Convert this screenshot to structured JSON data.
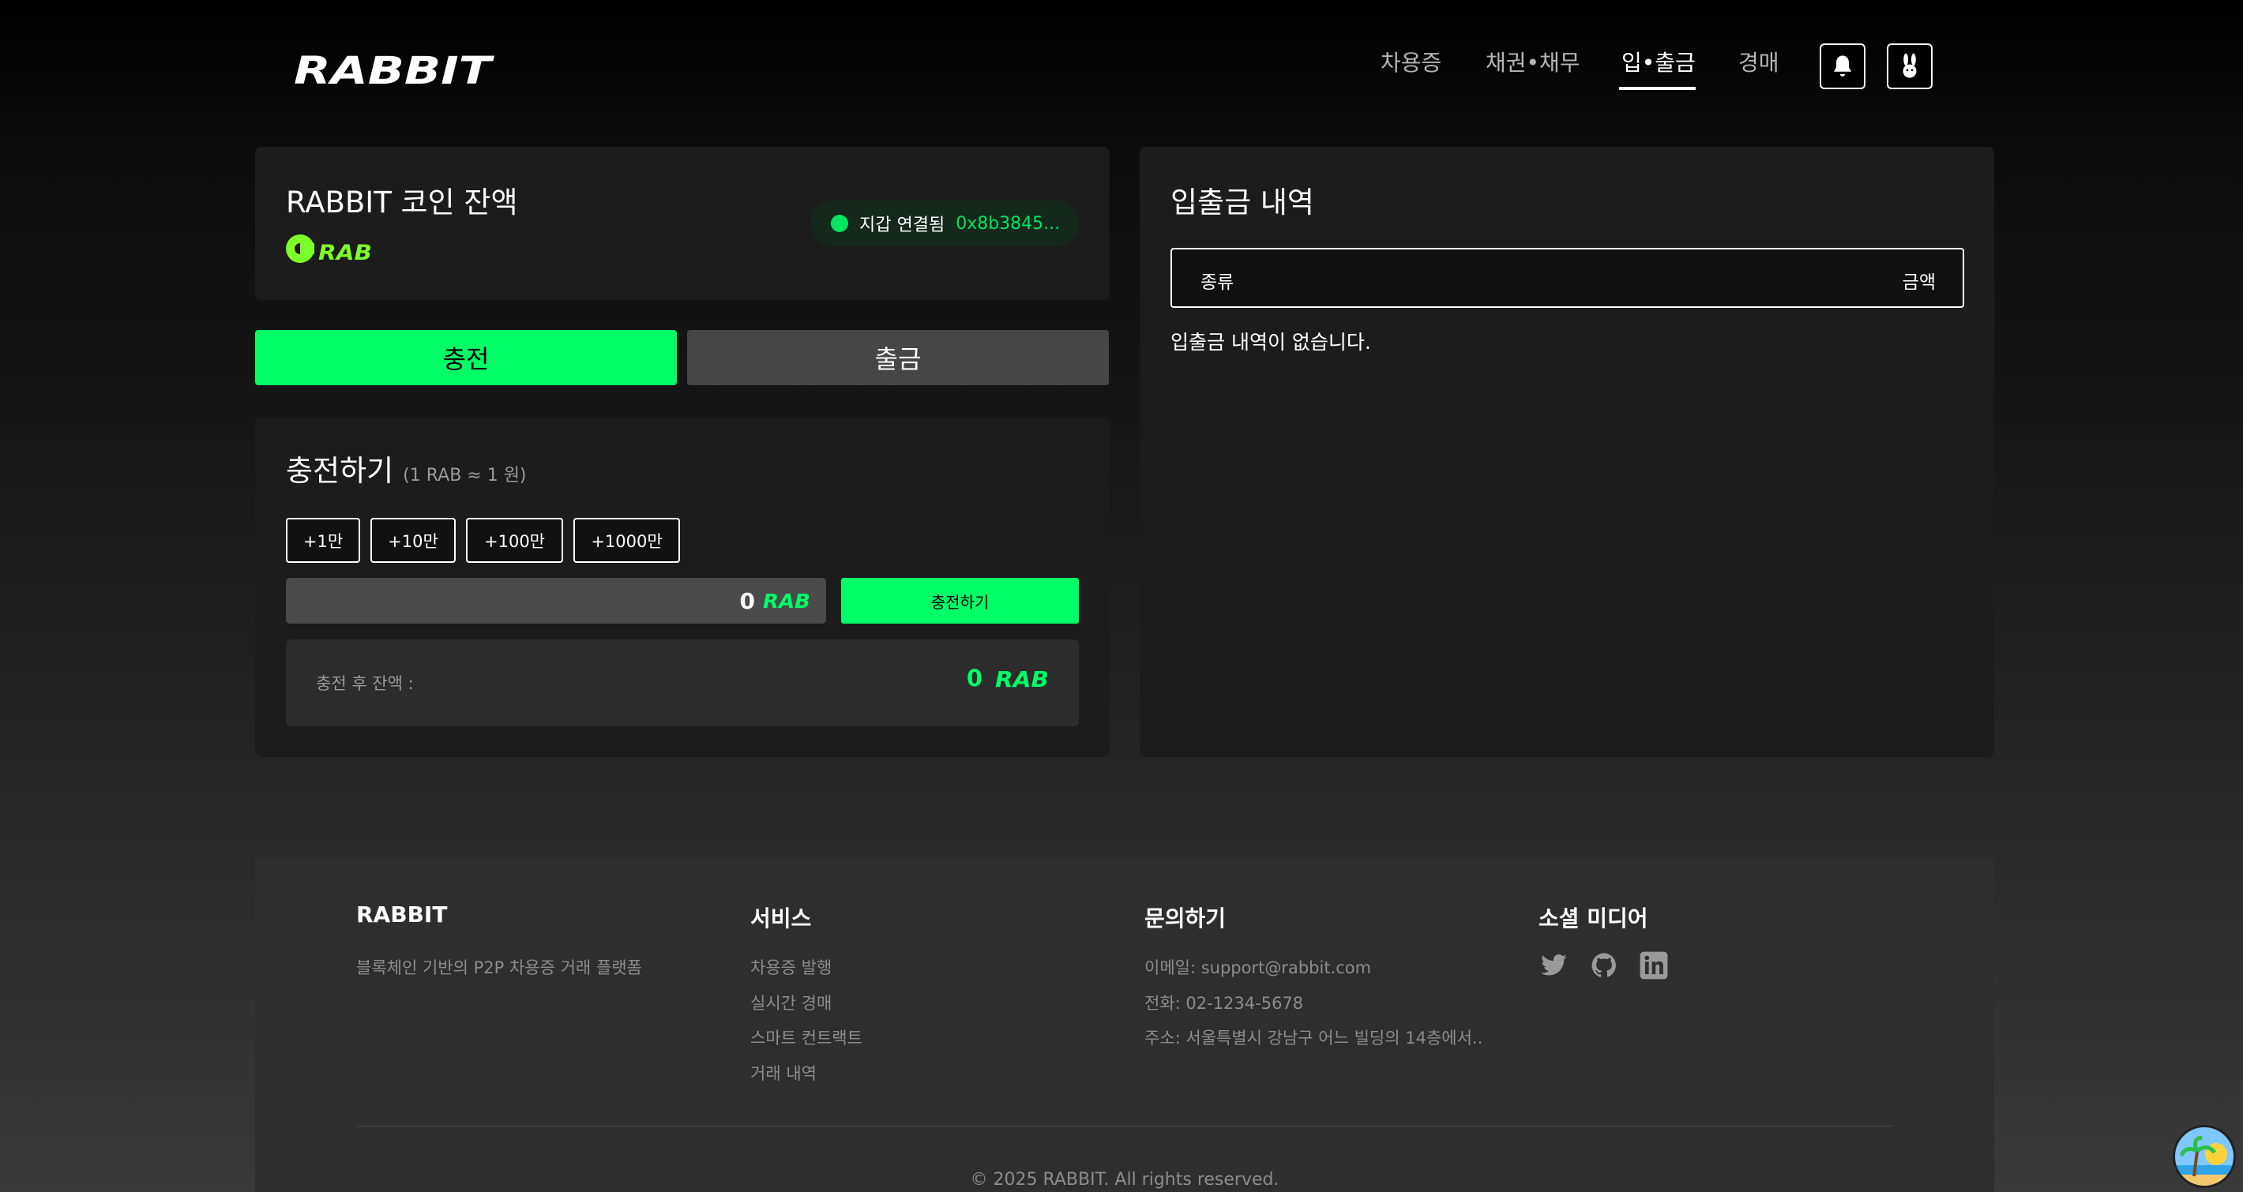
{
  "header": {
    "logo_text": "RABBIT",
    "nav": [
      "차용증",
      "채권•채무",
      "입•출금",
      "경매"
    ],
    "active_nav": "입•출금",
    "icons": [
      "bell-icon",
      "rabbit-profile-icon"
    ]
  },
  "balance": {
    "title": "RABBIT 코인 잔액",
    "coin_logo_text": "RAB",
    "wallet_status": "지갑 연결됨",
    "wallet_address": "0x8b3845..."
  },
  "tabs": {
    "charge": "충전",
    "withdraw": "출금"
  },
  "charge": {
    "title": "충전하기",
    "rate_note": "(1 RAB ≈ 1 원)",
    "presets": [
      "+1만",
      "+10만",
      "+100만",
      "+1000만"
    ],
    "amount_value": "0",
    "currency": "RAB",
    "submit_label": "충전하기",
    "after_label": "충전 후 잔액 :",
    "after_value": "0"
  },
  "history": {
    "title": "입출금 내역",
    "columns": [
      "종류",
      "금액"
    ],
    "empty_text": "입출금 내역이 없습니다."
  },
  "footer": {
    "brand": "RABBIT",
    "tagline": "블록체인 기반의 P2P 차용증 거래 플랫폼",
    "services_title": "서비스",
    "services": [
      "차용증 발행",
      "실시간 경매",
      "스마트 컨트랙트",
      "거래 내역"
    ],
    "contact_title": "문의하기",
    "contact": [
      "이메일: support@rabbit.com",
      "전화: 02-1234-5678",
      "주소: 서울특별시 강남구 어느 빌딩의 14층에서.."
    ],
    "social_title": "소셜 미디어",
    "social_icons": [
      "twitter-icon",
      "github-icon",
      "linkedin-icon"
    ],
    "copyright": "© 2025 RABBIT. All rights reserved."
  },
  "colors": {
    "accent": "#00ff66",
    "panel": "#1c1c1c",
    "footer": "#2e2e2e"
  }
}
